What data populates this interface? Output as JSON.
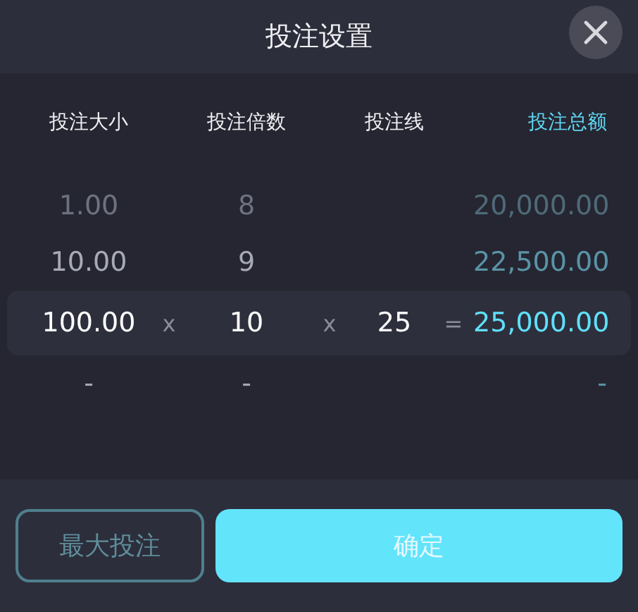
{
  "title": "投注设置",
  "columns": [
    "投注大小",
    "投注倍数",
    "投注线",
    "投注总额"
  ],
  "rows": [
    {
      "size": "1.00",
      "multiplier": "8",
      "total": "20,000.00",
      "selected": false
    },
    {
      "size": "10.00",
      "multiplier": "9",
      "total": "22,500.00",
      "selected": false
    },
    {
      "size": "100.00",
      "multiplier": "10",
      "lines": "25",
      "total": "25,000.00",
      "operators": [
        "x",
        "x",
        "="
      ],
      "selected": true
    },
    {
      "size": "-",
      "multiplier": "-",
      "total": "-",
      "selected": false
    }
  ],
  "buttons": [
    {
      "label": "最大投注",
      "kind": "outline"
    },
    {
      "label": "确定",
      "kind": "primary"
    }
  ]
}
